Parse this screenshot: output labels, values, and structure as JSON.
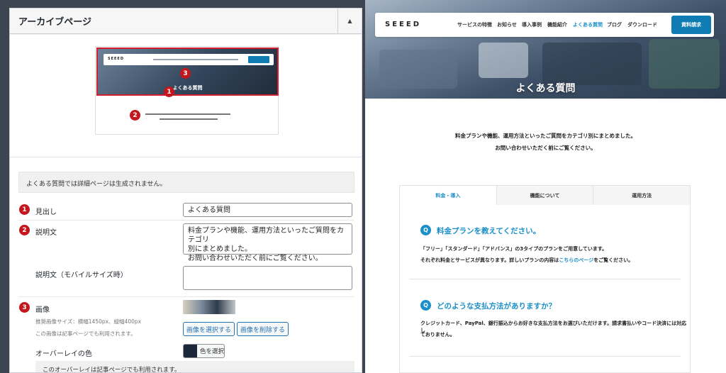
{
  "admin": {
    "title": "アーカイブページ",
    "notice": "よくある質問では詳細ページは生成されません。",
    "badges": [
      "1",
      "2",
      "3"
    ],
    "thumbnail": {
      "logo": "SEEED",
      "heading": "よくある質問"
    },
    "fields": {
      "heading_label": "見出し",
      "heading_value": "よくある質問",
      "desc_label": "説明文",
      "desc_line1": "料金プランや機能、運用方法といったご質問をカテゴリ",
      "desc_line2": "別にまとめました。",
      "desc_line3": "お問い合わせいただく前にご覧ください。",
      "desc_mobile_label": "説明文（モバイルサイズ時）",
      "image_label": "画像",
      "image_size_note": "推奨画像サイズ：横幅1450px、縦幅400px",
      "image_usage_note": "この画像は記事ページでも利用されます。",
      "select_image": "画像を選択する",
      "delete_image": "画像を削除する",
      "overlay_label": "オーバーレイの色",
      "select_color": "色を選択",
      "overlay_notice": "このオーバーレイは記事ページでも利用されます。"
    }
  },
  "site": {
    "logo": "SEEED",
    "nav": [
      "サービスの特徴",
      "お知らせ",
      "導入事例",
      "機能紹介",
      "よくある質問",
      "ブログ",
      "ダウンロード"
    ],
    "nav_active_index": 4,
    "cta": "資料請求",
    "hero_title": "よくある質問",
    "desc_line1": "料金プランや機能、運用方法といったご質問をカテゴリ別にまとめました。",
    "desc_line2": "お問い合わせいただく前にご覧ください。",
    "tabs": [
      "料金・導入",
      "機能について",
      "運用方法"
    ],
    "q_mark": "Q",
    "faq": [
      {
        "q": "料金プランを教えてください。",
        "a1": "「フリー」「スタンダード」「アドバンス」の3タイプのプランをご用意しています。",
        "a2_pre": "それぞれ料金とサービスが異なります。詳しいプランの内容は",
        "a2_link": "こちらのページ",
        "a2_post": "をご覧ください。"
      },
      {
        "q": "どのような支払方法がありますか？",
        "a1": "クレジットカード、PayPal、銀行振込からお好きな支払方法をお選びいただけます。請求書払いやコード決済には対応し",
        "a2": "ておりません。"
      }
    ]
  },
  "colors": {
    "accent": "#1a8fc9",
    "badge": "#c4161c",
    "cta": "#0f7db4",
    "overlay": "#1c2839"
  }
}
